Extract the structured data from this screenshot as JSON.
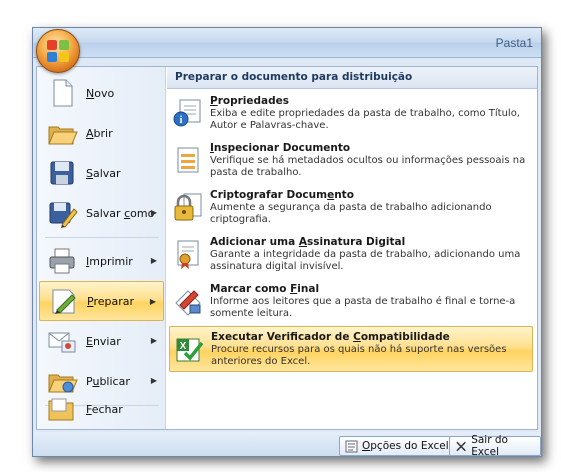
{
  "window": {
    "title": "Pasta1"
  },
  "left_menu": [
    {
      "id": "novo",
      "pre": "",
      "key": "N",
      "post": "ovo",
      "submenu": false,
      "icon": "new-document-icon"
    },
    {
      "id": "abrir",
      "pre": "",
      "key": "A",
      "post": "brir",
      "submenu": false,
      "icon": "open-folder-icon"
    },
    {
      "id": "salvar",
      "pre": "",
      "key": "S",
      "post": "alvar",
      "submenu": false,
      "icon": "save-disk-icon"
    },
    {
      "id": "salvar-como",
      "pre": "Salvar ",
      "key": "c",
      "post": "omo",
      "submenu": true,
      "icon": "save-as-icon"
    },
    {
      "id": "imprimir",
      "pre": "",
      "key": "I",
      "post": "mprimir",
      "submenu": true,
      "icon": "printer-icon"
    },
    {
      "id": "preparar",
      "pre": "",
      "key": "P",
      "post": "reparar",
      "submenu": true,
      "icon": "prepare-pen-icon",
      "active": true
    },
    {
      "id": "enviar",
      "pre": "",
      "key": "E",
      "post": "nviar",
      "submenu": true,
      "icon": "send-mail-icon"
    },
    {
      "id": "publicar",
      "pre": "P",
      "key": "u",
      "post": "blicar",
      "submenu": true,
      "icon": "publish-folder-icon"
    },
    {
      "id": "fechar",
      "pre": "",
      "key": "F",
      "post": "echar",
      "submenu": false,
      "icon": "close-folder-icon"
    }
  ],
  "right_panel": {
    "header": "Preparar o documento para distribuição",
    "items": [
      {
        "id": "propriedades",
        "pre": "",
        "key": "P",
        "post": "ropriedades",
        "desc": [
          "Exiba e edite propriedades da pasta de trabalho, como Título,",
          "Autor e Palavras-chave."
        ],
        "icon": "properties-icon"
      },
      {
        "id": "inspecionar",
        "pre": "",
        "key": "I",
        "post": "nspecionar Documento",
        "desc": [
          "Verifique se há metadados ocultos ou informações pessoais na",
          "pasta de trabalho."
        ],
        "icon": "inspect-document-icon"
      },
      {
        "id": "criptografar",
        "pre": "Criptografar Docum",
        "key": "e",
        "post": "nto",
        "desc": [
          "Aumente a segurança da pasta de trabalho adicionando",
          "criptografia."
        ],
        "icon": "encrypt-lock-icon"
      },
      {
        "id": "assinatura",
        "pre": "Adicionar uma ",
        "key": "A",
        "post": "ssinatura Digital",
        "desc": [
          "Garante a integridade da pasta de trabalho, adicionando uma",
          "assinatura digital invisível."
        ],
        "icon": "digital-signature-icon"
      },
      {
        "id": "marcar-final",
        "pre": "Marcar como ",
        "key": "F",
        "post": "inal",
        "desc": [
          "Informe aos leitores que a pasta de trabalho é final e torne-a",
          "somente leitura."
        ],
        "icon": "mark-final-icon"
      },
      {
        "id": "compatibilidade",
        "pre": "Executar Verificador de ",
        "key": "C",
        "post": "ompatibilidade",
        "desc": [
          "Procure recursos para os quais não há suporte nas versões",
          "anteriores do Excel."
        ],
        "icon": "compatibility-checker-icon",
        "active": true
      }
    ]
  },
  "bottom_buttons": {
    "options": {
      "pre": "",
      "key": "O",
      "post": "pções do Excel",
      "icon": "options-icon"
    },
    "exit": {
      "pre": "Sair do E",
      "key": "x",
      "post": "cel",
      "icon": "exit-x-icon"
    }
  }
}
